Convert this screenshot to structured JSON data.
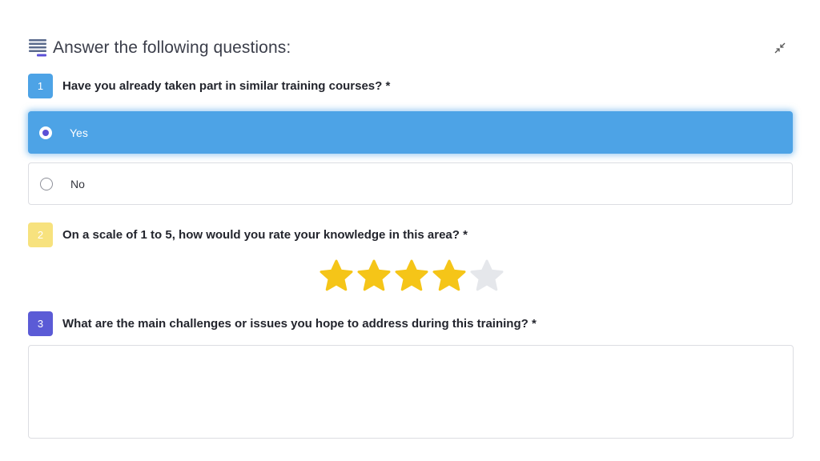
{
  "header": {
    "icon": "list-lines-icon",
    "title": "Answer the following questions:",
    "collapse_icon": "collapse-arrows-icon"
  },
  "questions": [
    {
      "number": "1",
      "text": "Have you already taken part in similar training courses? *",
      "badge_color": "#4da3e6",
      "options": [
        {
          "label": "Yes",
          "selected": true
        },
        {
          "label": "No",
          "selected": false
        }
      ]
    },
    {
      "number": "2",
      "text": "On a scale of 1 to 5, how would you rate your knowledge in this area? *",
      "badge_color": "#f7e27e",
      "rating": {
        "value": 4,
        "max": 5,
        "filled_color": "#f5c518",
        "empty_color": "#e5e7eb"
      }
    },
    {
      "number": "3",
      "text": "What are the main challenges or issues you hope to address during this training? *",
      "badge_color": "#5b5bd6",
      "answer": ""
    }
  ],
  "colors": {
    "selected_option": "#4da3e6",
    "radio_dot": "#5b4fd6",
    "border": "#dcdde2"
  }
}
